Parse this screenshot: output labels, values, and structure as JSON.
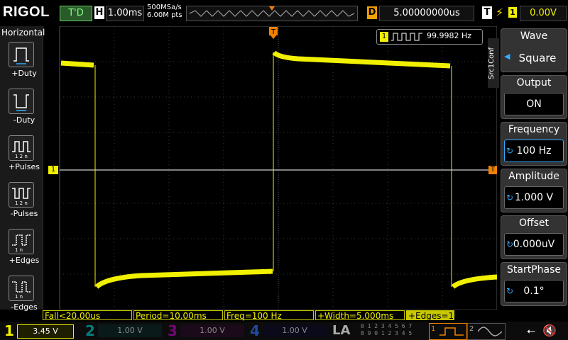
{
  "header": {
    "brand": "RIGOL",
    "run_state": "T'D",
    "horizontal_label": "H",
    "timebase": "1.00ms",
    "sample_rate": "500MSa/s",
    "memory_depth": "6.00M pts",
    "delay_label": "D",
    "delay_value": "5.00000000us",
    "trigger_label": "T",
    "trigger_source": "1",
    "trigger_level": "0.00V"
  },
  "left_menu": {
    "title": "Horizontal",
    "items": [
      {
        "label": "+Duty",
        "icon": "positive-duty-icon"
      },
      {
        "label": "-Duty",
        "icon": "negative-duty-icon"
      },
      {
        "label": "+Pulses",
        "icon": "positive-pulses-icon"
      },
      {
        "label": "-Pulses",
        "icon": "negative-pulses-icon"
      },
      {
        "label": "+Edges",
        "icon": "positive-edges-icon"
      },
      {
        "label": "-Edges",
        "icon": "negative-edges-icon"
      }
    ]
  },
  "frequency_counter": {
    "channel": "1",
    "value": "99.9982 Hz"
  },
  "markers": {
    "ch1_ground": "1",
    "trigger_pos": "T",
    "trigger_level": "T"
  },
  "right_menu": {
    "tab": "Src1Conf",
    "items": [
      {
        "title": "Wave",
        "value": "Square"
      },
      {
        "title": "Output",
        "value": "ON"
      },
      {
        "title": "Frequency",
        "value": "100 Hz"
      },
      {
        "title": "Amplitude",
        "value": "1.000 V"
      },
      {
        "title": "Offset",
        "value": "0.000uV"
      },
      {
        "title": "StartPhase",
        "value": "0.1°"
      }
    ]
  },
  "measurements": [
    "Fall<20.00us",
    "Period=10.00ms",
    "Freq=100 Hz",
    "+Width=5.000ms",
    "+Edges=1"
  ],
  "channels": [
    {
      "num": "1",
      "scale": "3.45 V",
      "color": "#f0f000"
    },
    {
      "num": "2",
      "scale": "1.00 V",
      "color": "#00c8c8"
    },
    {
      "num": "3",
      "scale": "1.00 V",
      "color": "#c000c0"
    },
    {
      "num": "4",
      "scale": "1.00 V",
      "color": "#3070ff"
    }
  ],
  "la_label": "LA",
  "la_digits_top": "0 1 2 3  4 5 6 7",
  "la_digits_bottom": "8 9 0 1  2 3 4 5",
  "source_labels": [
    "1",
    "2"
  ],
  "colors": {
    "ch1": "#f0f000",
    "trigger": "#f08000",
    "accent": "#3399ff"
  }
}
